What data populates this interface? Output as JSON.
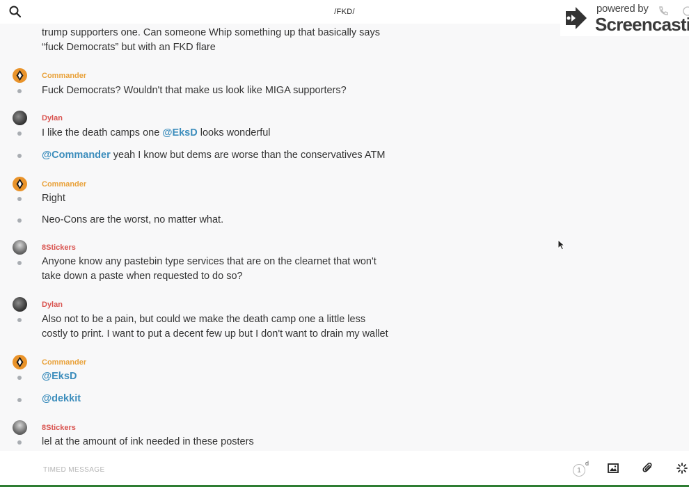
{
  "header": {
    "title": "/FKD/",
    "search_icon": "search-icon"
  },
  "watermark": {
    "powered": "powered by",
    "brand": "Screencastify"
  },
  "messages": [
    {
      "type": "continuation",
      "lines": [
        "trump supporters one. Can someone Whip something up that basically says",
        "“fuck Democrats” but with an FKD flare"
      ]
    },
    {
      "type": "header",
      "author": "Commander",
      "text": "Fuck Democrats? Wouldn't that make us look like MIGA supporters?"
    },
    {
      "type": "header",
      "author": "Dylan",
      "text_before": "I like the death camps one ",
      "mention": "@EksD",
      "text_after": " looks wonderful"
    },
    {
      "type": "followup",
      "mention": "@Commander",
      "text": " yeah I know but dems are worse than the conservatives ATM"
    },
    {
      "type": "header",
      "author": "Commander",
      "text": "Right"
    },
    {
      "type": "followup",
      "text": "Neo-Cons are the worst, no matter what."
    },
    {
      "type": "header",
      "author": "8Stickers",
      "lines": [
        "Anyone know any pastebin type services that are on the clearnet that won't",
        "take down a paste when requested to do so?"
      ]
    },
    {
      "type": "header",
      "author": "Dylan",
      "lines": [
        "Also not to be a pain, but could we make the death camp one a little less",
        "costly to print. I want to put a decent few up but I don't want to drain my wallet"
      ]
    },
    {
      "type": "header",
      "author": "Commander",
      "mention": "@EksD"
    },
    {
      "type": "followup",
      "mention": "@dekkit"
    },
    {
      "type": "header",
      "author": "8Stickers",
      "text": "lel at the amount of ink needed in these posters"
    }
  ],
  "composer": {
    "placeholder": "TIMED MESSAGE",
    "timer_value": "1",
    "timer_unit": "d"
  },
  "colors": {
    "commander": "#e9a23b",
    "user_red": "#d9534f",
    "mention": "#3c8dbc"
  }
}
